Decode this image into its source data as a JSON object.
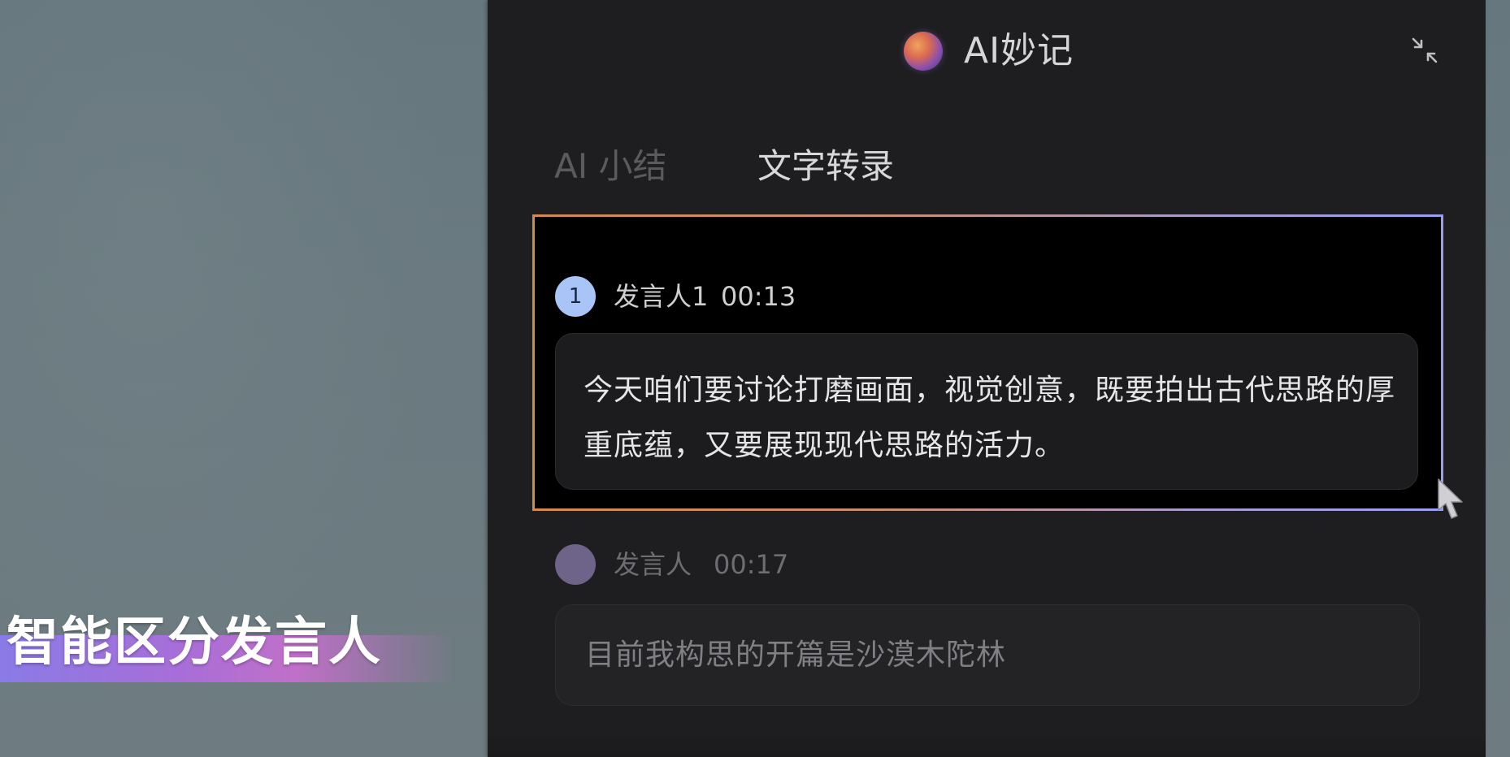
{
  "app": {
    "title": "AI妙记"
  },
  "icons": {
    "logo": "gradient-orb",
    "collapse": "collapse-arrows-icon",
    "cursor": "arrow-cursor"
  },
  "tabs": [
    {
      "label": "AI 小结",
      "active": false
    },
    {
      "label": "文字转录",
      "active": true
    }
  ],
  "transcript": [
    {
      "avatar_label": "1",
      "speaker": "发言人1",
      "time": "00:13",
      "text": "今天咱们要讨论打磨画面，视觉创意，既要拍出古代思路的厚重底蕴，又要展现现代思路的活力。",
      "highlighted": true
    },
    {
      "avatar_label": "",
      "speaker": "发言人",
      "time": "00:17",
      "text": "目前我构思的开篇是沙漠木陀林",
      "highlighted": false
    }
  ],
  "caption": {
    "text": "智能区分发言人"
  },
  "colors": {
    "accent": "#5d64c8",
    "avatar_1": "#a9c4f6",
    "avatar_2": "#6e6388",
    "highlight_start": "#d58a4a",
    "highlight_end": "#9a9ef0",
    "caption_gradient_start": "#8a7be6",
    "caption_gradient_end": "#c070c8"
  }
}
